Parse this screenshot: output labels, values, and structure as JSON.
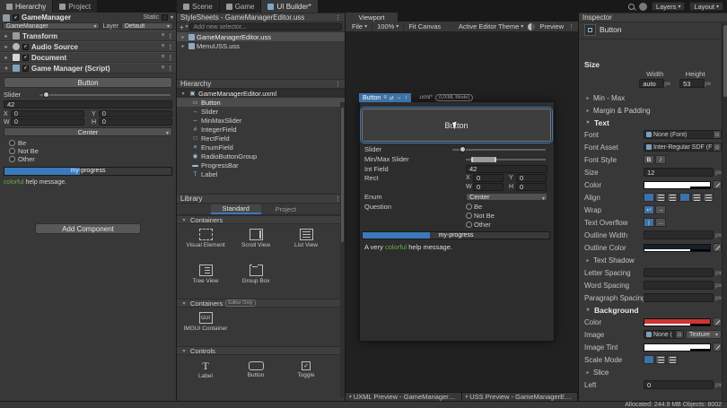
{
  "colors": {
    "accent": "#3a79bb",
    "selection": "#3d72a8",
    "help_green": "#6aa84f",
    "bg_red": "#cf3434"
  },
  "topbar": {
    "tabs_left": [
      "Hierarchy",
      "Project"
    ],
    "tabs_doc": [
      "Scene",
      "Game",
      "UI Builder*"
    ],
    "layers": "Layers",
    "layout": "Layout"
  },
  "left": {
    "name": "GameManager",
    "static_label": "Static",
    "tag": "GameManager",
    "layer_label": "Layer",
    "layer": "Default",
    "components": [
      "Transform",
      "Audio Source",
      "Document",
      "Game Manager (Script)"
    ],
    "button": "Button",
    "slider_label": "Slider",
    "int_value": "42",
    "x": "X",
    "y": "Y",
    "w": "W",
    "h": "H",
    "x_val": "0",
    "y_val": "0",
    "w_val": "0",
    "h_val": "0",
    "enum": "Center",
    "radios": [
      "Be",
      "Not Be",
      "Other"
    ],
    "progress": "my-progress",
    "help_colored": "colorful",
    "help_rest": " help message.",
    "add_component": "Add Component"
  },
  "builder": {
    "stylesheets_title": "StyleSheets - GameManagerEditor.uss",
    "add_selector_placeholder": "Add new selector...",
    "sheets": [
      "GameManagerEditor.uss",
      "MenuUSS.uss"
    ],
    "hierarchy_title": "Hierarchy",
    "uxml_root": "GameManagerEditor.uxml",
    "tree": [
      "Button",
      "Slider",
      "MinMaxSlider",
      "IntegerField",
      "RectField",
      "EnumField",
      "RadioButtonGroup",
      "ProgressBar",
      "Label"
    ],
    "library_title": "Library",
    "tab_standard": "Standard",
    "tab_project": "Project",
    "sec_containers": "Containers",
    "editor_only_badge": "Editor Only",
    "sec_controls": "Controls",
    "tiles_containers": [
      "Visual Element",
      "Scroll View",
      "List View",
      "Tree View",
      "Group Box"
    ],
    "tile_imgui": "IMGUI Container",
    "imgui_icon_text": "GUI",
    "label_icon_text": "T",
    "tiles_controls": [
      "Label",
      "Button",
      "Toggle"
    ]
  },
  "viewport": {
    "tab": "Viewport",
    "file": "File",
    "zoom": "100%",
    "fit": "Fit Canvas",
    "theme": "Active Editor Theme",
    "preview": "Preview",
    "canvas_selected": "Button",
    "canvas_title": "GameManagerEditor.uxml*",
    "canvas_badge": "(UXML Mode)",
    "button_label": "Button",
    "rows": {
      "slider": "Slider",
      "minmax": "Min/Max Slider",
      "int_field": "Int Field",
      "int_value": "42",
      "rect": "Rect",
      "x": "X",
      "y": "Y",
      "w": "W",
      "h": "H",
      "x_val": "0",
      "y_val": "0",
      "w_val": "0",
      "h_val": "0",
      "enum_label": "Enum",
      "enum_value": "Center",
      "question": "Question",
      "radios": [
        "Be",
        "Not Be",
        "Other"
      ],
      "progress": "my-progress",
      "help_prefix": "A very ",
      "help_colored": "colorful",
      "help_rest": " help message."
    },
    "uxml_preview": "UXML Preview - GameManagerEditor.uxml*",
    "uss_preview": "USS Preview - GameManagerEditor.uss"
  },
  "inspector": {
    "title": "Inspector",
    "element": "Button",
    "size_header": "Size",
    "width_label": "Width",
    "height_label": "Height",
    "width_value": "auto",
    "height_value": "53",
    "px": "px",
    "minmax": "Min - Max",
    "margin_padding": "Margin & Padding",
    "text_header": "Text",
    "rows": {
      "font": "Font",
      "font_value": "None (Font)",
      "font_asset": "Font Asset",
      "font_asset_value": "Inter-Regular SDF (F",
      "font_style": "Font Style",
      "bold": "B",
      "italic": "I",
      "size": "Size",
      "size_value": "12",
      "color": "Color",
      "align": "Align",
      "wrap": "Wrap",
      "text_overflow": "Text Overflow",
      "outline_width": "Outline Width",
      "outline_color": "Outline Color",
      "text_shadow": "Text Shadow",
      "letter_spacing": "Letter Spacing",
      "word_spacing": "Word Spacing",
      "paragraph_spacing": "Paragraph Spacing",
      "empty": ""
    },
    "background_header": "Background",
    "bg": {
      "color": "Color",
      "image": "Image",
      "image_value": "None (",
      "image_type": "Texture",
      "image_tint": "Image Tint",
      "scale_mode": "Scale Mode",
      "slice": "Slice",
      "left": "Left",
      "left_value": "0"
    }
  },
  "statusbar": {
    "allocated": "Allocated: 244.9 MB Objects: 8002"
  }
}
